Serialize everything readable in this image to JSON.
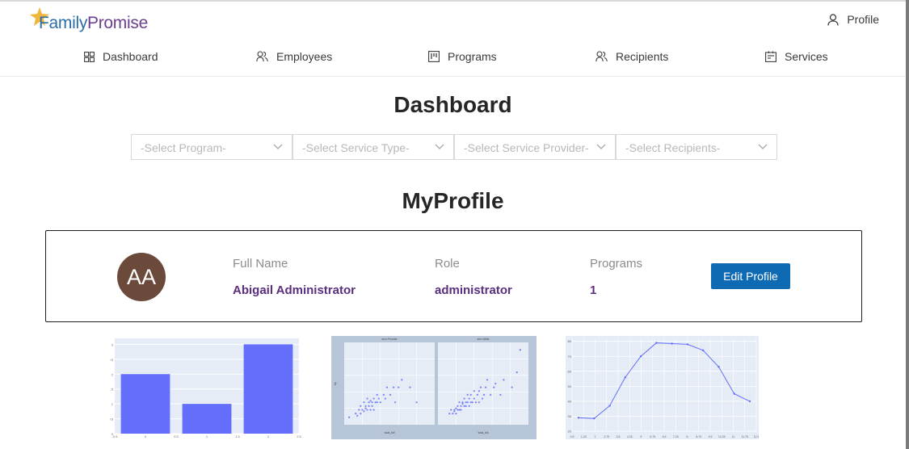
{
  "brand": {
    "logo_part1": "Family",
    "logo_part2": "Promise",
    "star_color": "#f0b73a"
  },
  "header": {
    "profile_label": "Profile"
  },
  "nav": {
    "items": [
      {
        "label": "Dashboard",
        "icon": "dashboard-icon"
      },
      {
        "label": "Employees",
        "icon": "employees-icon"
      },
      {
        "label": "Programs",
        "icon": "programs-icon"
      },
      {
        "label": "Recipients",
        "icon": "recipients-icon"
      },
      {
        "label": "Services",
        "icon": "services-icon"
      }
    ]
  },
  "main": {
    "title": "Dashboard",
    "filters": [
      {
        "placeholder": "-Select Program-"
      },
      {
        "placeholder": "-Select Service Type-"
      },
      {
        "placeholder": "-Select Service Provider-"
      },
      {
        "placeholder": "-Select Recipients-"
      }
    ],
    "profile_section_title": "MyProfile"
  },
  "profile": {
    "initials": "AA",
    "avatar_color": "#6b4a3c",
    "full_name_label": "Full Name",
    "full_name": "Abigail Administrator",
    "role_label": "Role",
    "role": "administrator",
    "programs_label": "Programs",
    "programs": "1",
    "edit_button": "Edit Profile",
    "accent_color": "#5b2e7e",
    "button_color": "#0f6ab4"
  },
  "chart_data": [
    {
      "type": "bar",
      "categories": [
        "0",
        "1",
        "2"
      ],
      "values": [
        2,
        1,
        3
      ],
      "ylim": [
        0,
        3.2
      ],
      "xticks": [
        "-0.5",
        "0",
        "0.5",
        "1",
        "1.5",
        "2",
        "2.5"
      ],
      "yticks": [
        "0",
        "0.5",
        "1",
        "1.5",
        "2",
        "2.5",
        "3"
      ],
      "bar_color": "#636efa",
      "plot_bg": "#e5ecf6"
    },
    {
      "type": "scatter",
      "subplot_titles": [
        "sex=Female",
        "sex=Male"
      ],
      "xlabel": "total_bill",
      "ylabel": "tip",
      "xlim": [
        0,
        55
      ],
      "ylim": [
        0,
        11
      ],
      "series": [
        {
          "points": [
            [
              3,
              1
            ],
            [
              7,
              1.5
            ],
            [
              8,
              1.2
            ],
            [
              9,
              2
            ],
            [
              10,
              1.5
            ],
            [
              10,
              2.5
            ],
            [
              11,
              2
            ],
            [
              12,
              1.8
            ],
            [
              12,
              3
            ],
            [
              13,
              2.2
            ],
            [
              13,
              2.5
            ],
            [
              14,
              2
            ],
            [
              14,
              3.5
            ],
            [
              15,
              2.5
            ],
            [
              15,
              3
            ],
            [
              16,
              2
            ],
            [
              16,
              3.2
            ],
            [
              17,
              2.5
            ],
            [
              17,
              3
            ],
            [
              18,
              3.5
            ],
            [
              18,
              2
            ],
            [
              19,
              3
            ],
            [
              20,
              3
            ],
            [
              20,
              4
            ],
            [
              21,
              3.5
            ],
            [
              22,
              3
            ],
            [
              24,
              4
            ],
            [
              25,
              3.5
            ],
            [
              26,
              5
            ],
            [
              28,
              4
            ],
            [
              30,
              5
            ],
            [
              31,
              3
            ],
            [
              33,
              5
            ],
            [
              35,
              6
            ],
            [
              40,
              5
            ],
            [
              44,
              3
            ]
          ]
        },
        {
          "points": [
            [
              7,
              1.5
            ],
            [
              8,
              2
            ],
            [
              9,
              1.5
            ],
            [
              10,
              1.8
            ],
            [
              10,
              2
            ],
            [
              11,
              2.2
            ],
            [
              11,
              1.5
            ],
            [
              12,
              2
            ],
            [
              12,
              2.5
            ],
            [
              13,
              2
            ],
            [
              13,
              3
            ],
            [
              14,
              2.5
            ],
            [
              14,
              2
            ],
            [
              15,
              2.8
            ],
            [
              15,
              3
            ],
            [
              16,
              2.5
            ],
            [
              16,
              3.5
            ],
            [
              17,
              2.5
            ],
            [
              17,
              3
            ],
            [
              18,
              3
            ],
            [
              18,
              4
            ],
            [
              19,
              2.5
            ],
            [
              19,
              3.5
            ],
            [
              20,
              3
            ],
            [
              20,
              4
            ],
            [
              21,
              3
            ],
            [
              22,
              3.5
            ],
            [
              22,
              4.5
            ],
            [
              23,
              3
            ],
            [
              24,
              4
            ],
            [
              25,
              4.5
            ],
            [
              25,
              3
            ],
            [
              26,
              5
            ],
            [
              27,
              3.5
            ],
            [
              28,
              4
            ],
            [
              29,
              5
            ],
            [
              30,
              6
            ],
            [
              32,
              4
            ],
            [
              34,
              5
            ],
            [
              35,
              5.5
            ],
            [
              38,
              4
            ],
            [
              40,
              6
            ],
            [
              45,
              5
            ],
            [
              48,
              7
            ],
            [
              50,
              10
            ]
          ]
        }
      ],
      "point_color": "#636efa",
      "plot_bg": "#e5ecf6",
      "paper_bg": "#b6c6d8"
    },
    {
      "type": "line",
      "x": [
        0.5,
        1.25,
        2,
        2.75,
        3.5,
        4.25,
        5,
        5.75,
        6.5,
        7.25,
        8,
        8.75,
        9.5,
        10.25,
        11,
        11.75,
        12.5
      ],
      "values": [
        29,
        28.5,
        37,
        56,
        70,
        79,
        78.5,
        78,
        74,
        63,
        45,
        40
      ],
      "x_points": [
        0.5,
        2,
        3.5,
        5,
        6.5,
        8,
        9.5,
        11,
        12.5,
        14,
        15.5,
        17
      ],
      "xticks": [
        "0.5",
        "1.25",
        "2",
        "2.75",
        "3.5",
        "4.25",
        "5",
        "5.75",
        "6.5",
        "7.25",
        "8",
        "8.75",
        "9.5",
        "10.25",
        "11",
        "11.75",
        "12.5"
      ],
      "yticks": [
        "20",
        "30",
        "40",
        "50",
        "60",
        "70",
        "80"
      ],
      "ylim": [
        20,
        82
      ],
      "line_color": "#636efa",
      "plot_bg": "#e5ecf6"
    }
  ]
}
